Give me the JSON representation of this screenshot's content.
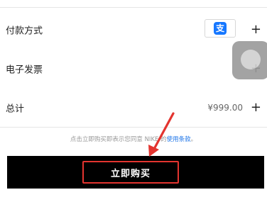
{
  "rows": {
    "payment": {
      "label": "付款方式",
      "plus": "+"
    },
    "invoice": {
      "label": "电子发票",
      "plus": "+"
    },
    "total": {
      "label": "总计",
      "value": "¥999.00",
      "plus": "+"
    }
  },
  "payment_icon": {
    "name": "alipay-icon",
    "glyph": "支",
    "color": "#1677ff"
  },
  "terms": {
    "prefix": "点击立即购买即表示您同意 NIKE 的",
    "link": "使用条款",
    "suffix": "。"
  },
  "buy_button": {
    "label": "立即购买"
  },
  "colors": {
    "annotation_red": "#e3342f",
    "bar_black": "#000000",
    "link_blue": "#1a73e8"
  }
}
